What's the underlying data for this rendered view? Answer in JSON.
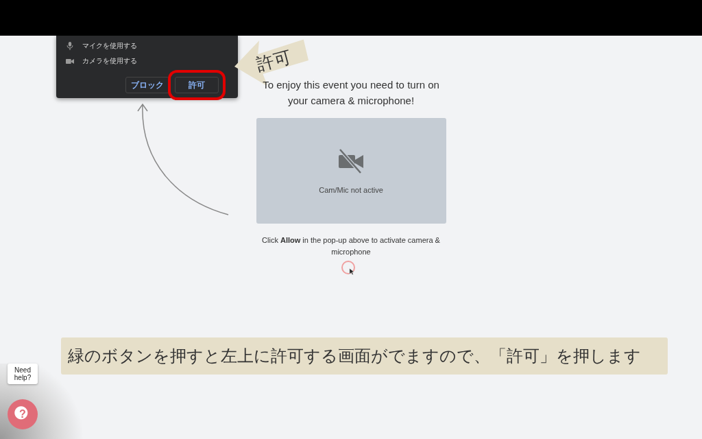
{
  "permission_popup": {
    "items": [
      {
        "kind": "mic",
        "label": "マイクを使用する"
      },
      {
        "kind": "camera",
        "label": "カメラを使用する"
      }
    ],
    "buttons": [
      {
        "label": "ブロック",
        "highlighted": false
      },
      {
        "label": "許可",
        "highlighted": true
      }
    ]
  },
  "annotation": {
    "label": "許可"
  },
  "main": {
    "heading": "To enjoy this event you need to turn on your camera & microphone!",
    "preview_status": "Cam/Mic not active",
    "instruction": "Click **Allow** in the pop-up above to activate camera & microphone"
  },
  "caption": "緑のボタンを押すと左上に許可する画面がでますので、「許可」を押します",
  "help": {
    "tooltip": "Need help?",
    "icon_char": "?"
  }
}
